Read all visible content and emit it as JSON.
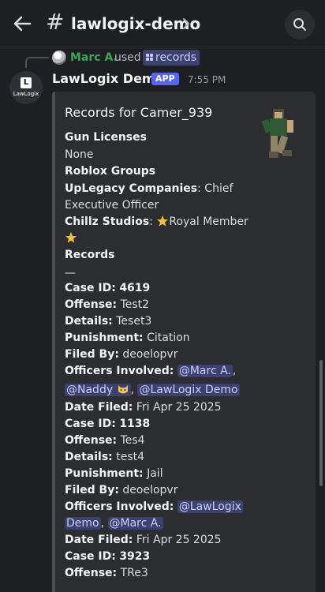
{
  "header": {
    "channel_name": "lawlogix-demo",
    "hash_glyph": "#"
  },
  "reply": {
    "user": "Marc A.",
    "used": "used",
    "command": "records"
  },
  "message": {
    "author": "LawLogix Demo",
    "badge": "APP",
    "timestamp": "7:55 PM",
    "avatar_text": "LawLogix",
    "avatar_letter": "L"
  },
  "embed": {
    "title": "Records for Camer_939",
    "gun_licenses_label": "Gun Licenses",
    "gun_licenses_value": "None",
    "roblox_groups_label": "Roblox Groups",
    "group1_name": "UpLegacy Companies",
    "group1_role_a": ": Chief",
    "group1_role_b": "Executive Officer",
    "group2_name": "Chillz Studios",
    "group2_sep": ": ",
    "group2_role": "Royal Member",
    "records_label": "Records",
    "divider_text": "—",
    "records": [
      {
        "case_label": "Case ID:",
        "case_id": "4619",
        "offense_label": "Offense:",
        "offense": "Test2",
        "details_label": "Details:",
        "details": "Teset3",
        "punishment_label": "Punishment:",
        "punishment": "Citation",
        "filed_by_label": "Filed By:",
        "filed_by": "deoelopvr",
        "officers_label": "Officers Involved:",
        "officer_1": "@Marc A.",
        "officer_2": "@Naddy",
        "officer_3": "@LawLogix Demo",
        "date_label": "Date Filed:",
        "date": "Fri Apr 25 2025"
      },
      {
        "case_label": "Case ID:",
        "case_id": "1138",
        "offense_label": "Offense:",
        "offense": "Tes4",
        "details_label": "Details:",
        "details": "test4",
        "punishment_label": "Punishment:",
        "punishment": "Jail",
        "filed_by_label": "Filed By:",
        "filed_by": "deoelopvr",
        "officers_label": "Officers Involved:",
        "officer_1a": "@LawLogix",
        "officer_1b": "Demo",
        "officer_2": "@Marc A.",
        "date_label": "Date Filed:",
        "date": "Fri Apr 25 2025"
      },
      {
        "case_label": "Case ID:",
        "case_id": "3923",
        "offense_label": "Offense:",
        "offense": "TRe3"
      }
    ],
    "comma": ","
  },
  "icons": {
    "back": "arrow-left-icon",
    "chevron": "chevron-right-icon",
    "search": "search-icon",
    "command": "slash-command-icon",
    "star": "star-emoji",
    "cat": "cat-emoji"
  },
  "colors": {
    "background": "#1e1f22",
    "embed_bg": "#2b2d31",
    "mention_bg": "#3c4270",
    "mention_fg": "#c9cdfb",
    "app_badge": "#5865f2",
    "reply_user": "#3ba55c"
  }
}
